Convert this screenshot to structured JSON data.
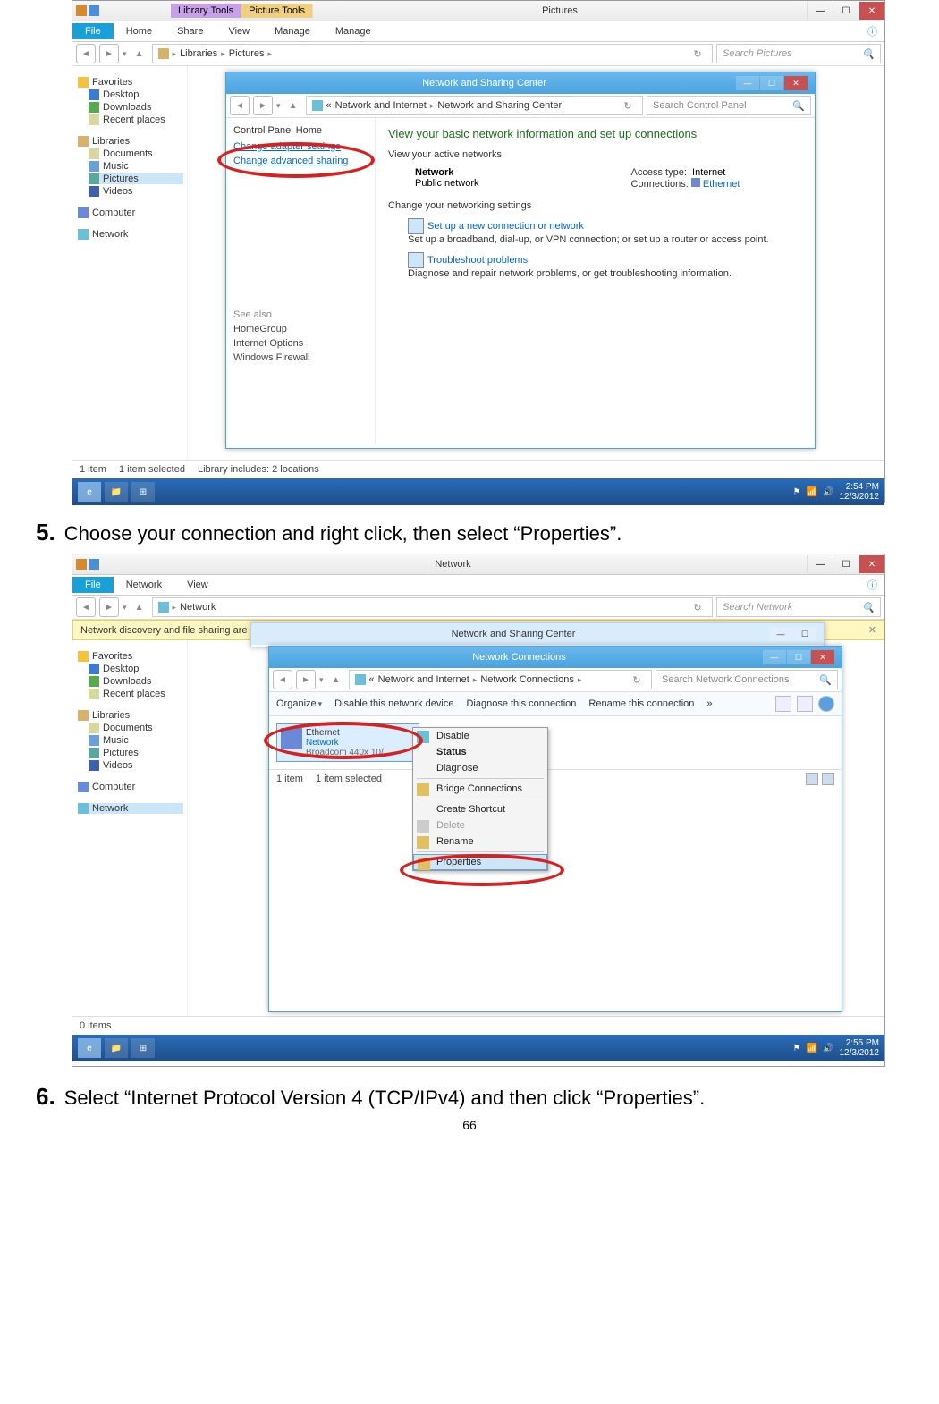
{
  "step5": {
    "num": "5.",
    "text": "Choose your connection and right click, then select “Properties”."
  },
  "step6": {
    "num": "6.",
    "text": "Select “Internet Protocol Version 4 (TCP/IPv4) and then click “Properties”."
  },
  "page_number": "66",
  "s1": {
    "title": "Pictures",
    "contextTabs": {
      "a": "Library Tools",
      "b": "Picture Tools"
    },
    "ribbon": {
      "file": "File",
      "home": "Home",
      "share": "Share",
      "view": "View",
      "manage1": "Manage",
      "manage2": "Manage"
    },
    "nav": {
      "path": [
        "Libraries",
        "Pictures"
      ],
      "search": "Search Pictures"
    },
    "tree": {
      "fav": "Favorites",
      "desktop": "Desktop",
      "downloads": "Downloads",
      "recent": "Recent places",
      "lib": "Libraries",
      "documents": "Documents",
      "music": "Music",
      "pictures": "Pictures",
      "videos": "Videos",
      "computer": "Computer",
      "network": "Network"
    },
    "status": {
      "a": "1 item",
      "b": "1 item selected",
      "c": "Library includes: 2 locations"
    },
    "dlg": {
      "title": "Network and Sharing Center",
      "path": [
        "Network and Internet",
        "Network and Sharing Center"
      ],
      "search": "Search Control Panel",
      "side": {
        "home": "Control Panel Home",
        "adapter": "Change adapter settings",
        "advanced": "Change advanced sharing",
        "also": "See also",
        "hg": "HomeGroup",
        "io": "Internet Options",
        "wf": "Windows Firewall"
      },
      "top": "View your basic network information and set up connections",
      "active_h": "View your active networks",
      "net_name": "Network",
      "net_sub": "Public network",
      "access_l": "Access type:",
      "access_v": "Internet",
      "conn_l": "Connections:",
      "conn_v": "Ethernet",
      "change_h": "Change your networking settings",
      "item1": "Set up a new connection or network",
      "item1d": "Set up a broadband, dial-up, or VPN connection; or set up a router or access point.",
      "item2": "Troubleshoot problems",
      "item2d": "Diagnose and repair network problems, or get troubleshooting information."
    },
    "clock": {
      "time": "2:54 PM",
      "date": "12/3/2012"
    }
  },
  "s2": {
    "title": "Network",
    "ribbon": {
      "file": "File",
      "network": "Network",
      "view": "View"
    },
    "nav": {
      "path": "Network",
      "search": "Search Network"
    },
    "infobar": "Network discovery and file sharing are turned off. Network computers and devices are not visible. Click to change...",
    "dlg1_title": "Network and Sharing Center",
    "dlg": {
      "title": "Network Connections",
      "path": [
        "Network and Internet",
        "Network Connections"
      ],
      "search": "Search Network Connections",
      "org": "Organize",
      "disable": "Disable this network device",
      "diag": "Diagnose this connection",
      "rename": "Rename this connection",
      "item": {
        "l1": "Ethernet",
        "l2": "Network",
        "l3": "Broadcom 440x 10/..."
      },
      "ctx": [
        "Disable",
        "Status",
        "Diagnose",
        "Bridge Connections",
        "Create Shortcut",
        "Delete",
        "Rename",
        "Properties"
      ],
      "status": {
        "a": "1 item",
        "b": "1 item selected"
      }
    },
    "outer_status": "0 items",
    "clock": {
      "time": "2:55 PM",
      "date": "12/3/2012"
    }
  }
}
